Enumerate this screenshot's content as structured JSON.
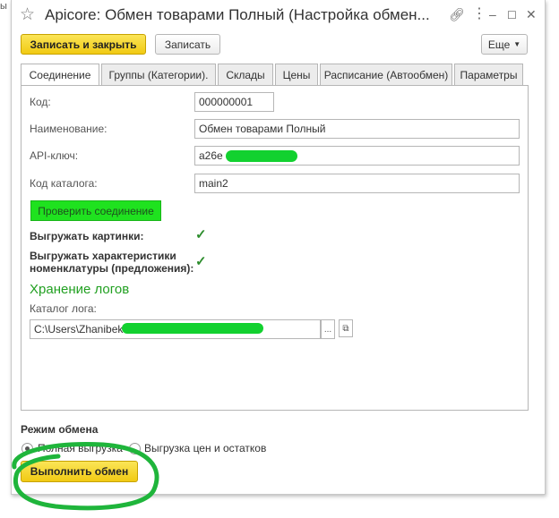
{
  "edge_text": "ы",
  "window": {
    "title": "Apicore: Обмен товарами Полный (Настройка обмен...",
    "icons": {
      "star": "star-icon",
      "link": "link-icon",
      "menu": "more-icon",
      "minimize": "minimize-icon",
      "maximize": "maximize-icon",
      "close": "close-icon"
    }
  },
  "toolbar": {
    "save_close_label": "Записать и закрыть",
    "save_label": "Записать",
    "more_label": "Еще"
  },
  "tabs": [
    {
      "label": "Соединение"
    },
    {
      "label": "Группы (Категории)."
    },
    {
      "label": "Склады"
    },
    {
      "label": "Цены"
    },
    {
      "label": "Расписание (Автообмен)"
    },
    {
      "label": "Параметры"
    }
  ],
  "connection": {
    "code_label": "Код:",
    "code_value": "000000001",
    "name_label": "Наименование:",
    "name_value": "Обмен товарами Полный",
    "api_key_label": "API-ключ:",
    "api_key_value": "a26e",
    "catalog_code_label": "Код каталога:",
    "catalog_code_value": "main2",
    "check_connection_label": "Проверить соединение",
    "export_images_label": "Выгружать картинки:",
    "export_images_checked": true,
    "export_characteristics_label_1": "Выгружать характеристики",
    "export_characteristics_label_2": "номенклатуры (предложения):",
    "export_characteristics_checked": true,
    "logs_section_title": "Хранение логов",
    "log_dir_label": "Каталог лога:",
    "log_dir_value": "C:\\Users\\Zhanibek",
    "browse_label": "...",
    "open_label": "⧉"
  },
  "exchange_mode": {
    "title": "Режим обмена",
    "options": [
      {
        "label": "Полная выгрузка",
        "selected": true
      },
      {
        "label": "Выгрузка цен и остатков",
        "selected": false
      }
    ],
    "run_label": "Выполнить обмен"
  },
  "colors": {
    "primary_yellow": "#f5d326",
    "check_green": "#1fe21f",
    "section_green": "#21a021",
    "annotation_green": "#1fb53b"
  }
}
